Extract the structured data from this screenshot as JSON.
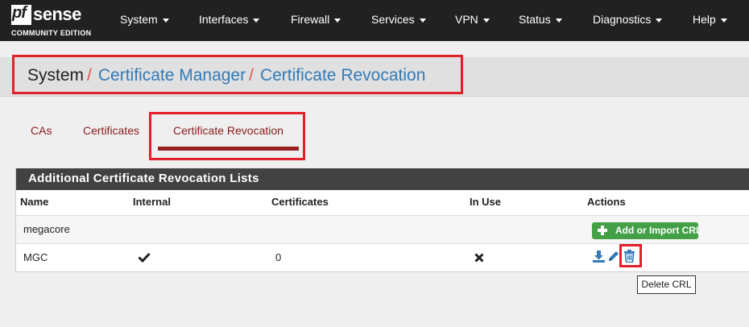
{
  "brand": {
    "logo_pf": "pf",
    "logo_sense": "sense",
    "edition": "COMMUNITY EDITION"
  },
  "nav": {
    "items": [
      "System",
      "Interfaces",
      "Firewall",
      "Services",
      "VPN",
      "Status",
      "Diagnostics",
      "Help"
    ]
  },
  "breadcrumb": {
    "root": "System",
    "separator": "/",
    "level1": "Certificate Manager",
    "level2": "Certificate Revocation"
  },
  "tabs": {
    "cas": "CAs",
    "certificates": "Certificates",
    "revocation": "Certificate Revocation",
    "active": "Certificate Revocation"
  },
  "panel": {
    "title": "Additional Certificate Revocation Lists",
    "columns": [
      "Name",
      "Internal",
      "Certificates",
      "In Use",
      "Actions"
    ],
    "rows": [
      {
        "name": "megacore",
        "internal": "",
        "certificates": "",
        "in_use": "",
        "action_button": "Add or Import CRL"
      },
      {
        "name": "MGC",
        "internal_icon": "check-icon",
        "certificates": "0",
        "in_use_icon": "x-icon",
        "actions": [
          "download-icon",
          "pencil-icon",
          "trash-icon"
        ]
      }
    ]
  },
  "tooltip": {
    "text": "Delete CRL"
  },
  "colors": {
    "navbar": "#212121",
    "link": "#337ab7",
    "tab_text": "#8a1c1c",
    "accent_red": "#e0202a",
    "success": "#43a047",
    "panel_head": "#424242"
  }
}
